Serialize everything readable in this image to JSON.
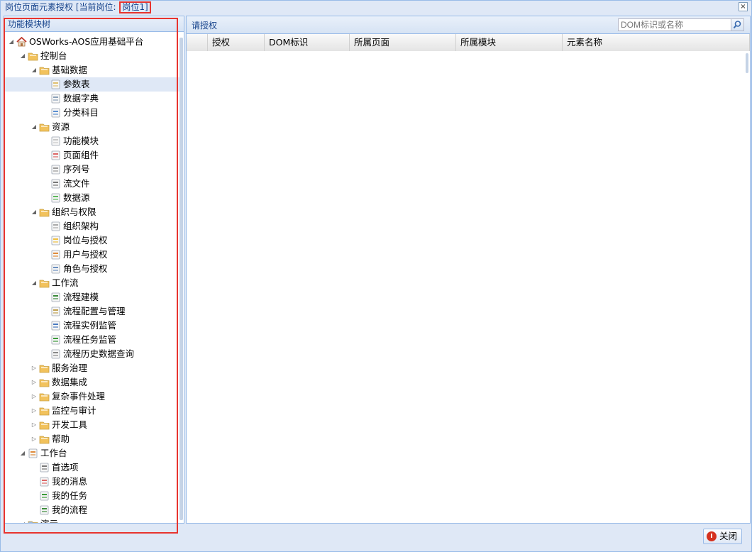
{
  "window": {
    "title_prefix": "岗位页面元素授权 [当前岗位: ",
    "current_post": "岗位1]",
    "close_glyph": "×"
  },
  "tree_panel": {
    "title": "功能模块树"
  },
  "tree": [
    {
      "label": "OSWorks-AOS应用基础平台",
      "depth": 0,
      "state": "open",
      "icon": "home-icon",
      "color": "#d9534f"
    },
    {
      "label": "控制台",
      "depth": 1,
      "state": "open",
      "icon": "folder-icon",
      "color": "#f2c25c"
    },
    {
      "label": "基础数据",
      "depth": 2,
      "state": "open",
      "icon": "folder-icon",
      "color": "#f2c25c"
    },
    {
      "label": "参数表",
      "depth": 3,
      "state": "leaf",
      "icon": "document-edit-icon",
      "color": "#e0c070",
      "selected": true
    },
    {
      "label": "数据字典",
      "depth": 3,
      "state": "leaf",
      "icon": "dictionary-icon",
      "color": "#8aa0b8"
    },
    {
      "label": "分类科目",
      "depth": 3,
      "state": "leaf",
      "icon": "list-icon",
      "color": "#5b8fd0"
    },
    {
      "label": "资源",
      "depth": 2,
      "state": "open",
      "icon": "folder-icon",
      "color": "#f2c25c"
    },
    {
      "label": "功能模块",
      "depth": 3,
      "state": "leaf",
      "icon": "page-icon",
      "color": "#c8c8c8"
    },
    {
      "label": "页面组件",
      "depth": 3,
      "state": "leaf",
      "icon": "components-icon",
      "color": "#d66"
    },
    {
      "label": "序列号",
      "depth": 3,
      "state": "leaf",
      "icon": "sequence-icon",
      "color": "#999"
    },
    {
      "label": "流文件",
      "depth": 3,
      "state": "leaf",
      "icon": "file-icon",
      "color": "#777"
    },
    {
      "label": "数据源",
      "depth": 3,
      "state": "leaf",
      "icon": "datasource-icon",
      "color": "#5cb85c"
    },
    {
      "label": "组织与权限",
      "depth": 2,
      "state": "open",
      "icon": "folder-icon",
      "color": "#f2c25c"
    },
    {
      "label": "组织架构",
      "depth": 3,
      "state": "leaf",
      "icon": "org-chart-icon",
      "color": "#aaa"
    },
    {
      "label": "岗位与授权",
      "depth": 3,
      "state": "leaf",
      "icon": "shield-icon",
      "color": "#f0c040"
    },
    {
      "label": "用户与授权",
      "depth": 3,
      "state": "leaf",
      "icon": "users-icon",
      "color": "#e08a3a"
    },
    {
      "label": "角色与授权",
      "depth": 3,
      "state": "leaf",
      "icon": "role-icon",
      "color": "#6a8fc0"
    },
    {
      "label": "工作流",
      "depth": 2,
      "state": "open",
      "icon": "folder-icon",
      "color": "#f2c25c"
    },
    {
      "label": "流程建模",
      "depth": 3,
      "state": "leaf",
      "icon": "modeling-icon",
      "color": "#3a8a3a"
    },
    {
      "label": "流程配置与管理",
      "depth": 3,
      "state": "leaf",
      "icon": "config-icon",
      "color": "#c0a050"
    },
    {
      "label": "流程实例监管",
      "depth": 3,
      "state": "leaf",
      "icon": "instance-icon",
      "color": "#4a7ac0"
    },
    {
      "label": "流程任务监管",
      "depth": 3,
      "state": "leaf",
      "icon": "task-icon",
      "color": "#3a9a3a"
    },
    {
      "label": "流程历史数据查询",
      "depth": 3,
      "state": "leaf",
      "icon": "history-icon",
      "color": "#888"
    },
    {
      "label": "服务治理",
      "depth": 2,
      "state": "closed",
      "icon": "folder-icon",
      "color": "#f2c25c"
    },
    {
      "label": "数据集成",
      "depth": 2,
      "state": "closed",
      "icon": "folder-icon",
      "color": "#f2c25c"
    },
    {
      "label": "复杂事件处理",
      "depth": 2,
      "state": "closed",
      "icon": "folder-icon",
      "color": "#f2c25c"
    },
    {
      "label": "监控与审计",
      "depth": 2,
      "state": "closed",
      "icon": "folder-icon",
      "color": "#f2c25c"
    },
    {
      "label": "开发工具",
      "depth": 2,
      "state": "closed",
      "icon": "folder-icon",
      "color": "#f2c25c"
    },
    {
      "label": "帮助",
      "depth": 2,
      "state": "closed",
      "icon": "folder-icon",
      "color": "#f2c25c"
    },
    {
      "label": "工作台",
      "depth": 1,
      "state": "open",
      "icon": "workbench-icon",
      "color": "#e08a3a"
    },
    {
      "label": "首选项",
      "depth": 2,
      "state": "leaf",
      "icon": "tools-icon",
      "color": "#777"
    },
    {
      "label": "我的消息",
      "depth": 2,
      "state": "leaf",
      "icon": "message-icon",
      "color": "#d66"
    },
    {
      "label": "我的任务",
      "depth": 2,
      "state": "leaf",
      "icon": "task-icon",
      "color": "#3a9a3a"
    },
    {
      "label": "我的流程",
      "depth": 2,
      "state": "leaf",
      "icon": "modeling-icon",
      "color": "#3a8a3a"
    },
    {
      "label": "演示",
      "depth": 1,
      "state": "open",
      "icon": "folder-icon",
      "color": "#9ab8e0"
    }
  ],
  "grid_panel": {
    "title": "请授权",
    "search_placeholder": "DOM标识或名称",
    "columns": [
      "授权",
      "DOM标识",
      "所属页面",
      "所属模块",
      "元素名称"
    ]
  },
  "footer": {
    "close_label": "关闭"
  }
}
